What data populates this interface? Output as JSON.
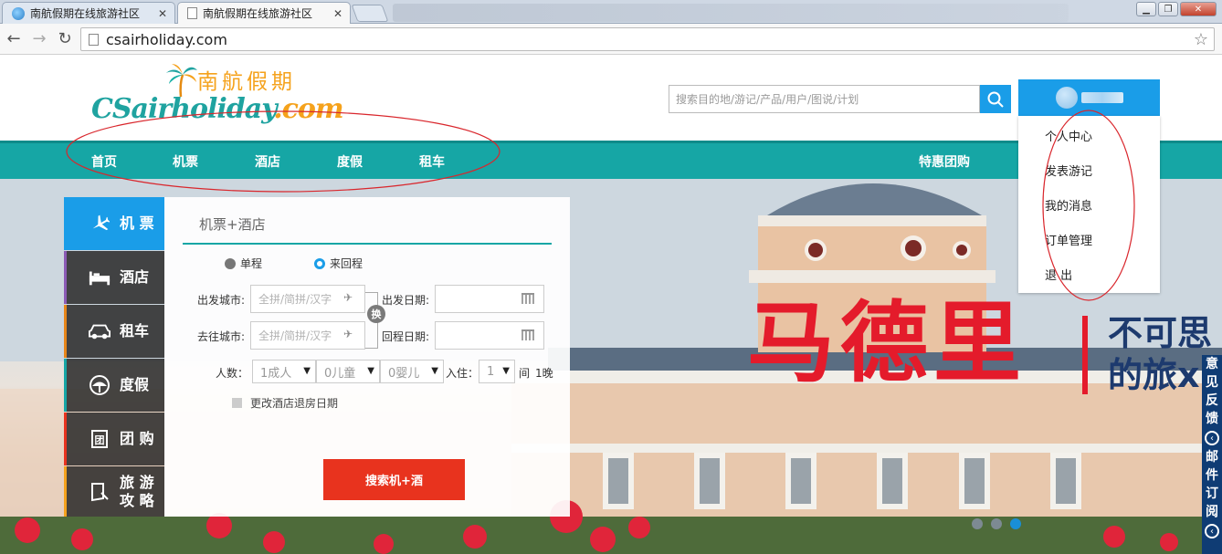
{
  "browser": {
    "tabs": [
      {
        "title": "南航假期在线旅游社区",
        "active": false
      },
      {
        "title": "南航假期在线旅游社区",
        "active": true
      }
    ],
    "url": "csairholiday.com"
  },
  "header": {
    "logo_cn": "南航假期",
    "logo_brand": "CSairholiday",
    "logo_suffix": ".com",
    "search_placeholder": "搜索目的地/游记/产品/用户/图说/计划"
  },
  "nav": {
    "items": [
      "首页",
      "机票",
      "酒店",
      "度假",
      "租车"
    ],
    "special": "特惠团购"
  },
  "user_menu": {
    "items": [
      "个人中心",
      "发表游记",
      "我的消息",
      "订单管理",
      "退 出"
    ]
  },
  "sidebar": {
    "items": [
      {
        "label": "机 票",
        "icon": "plane-icon"
      },
      {
        "label": "酒店",
        "icon": "bed-icon"
      },
      {
        "label": "租车",
        "icon": "car-icon"
      },
      {
        "label": "度假",
        "icon": "umbrella-icon"
      },
      {
        "label": "团 购",
        "icon": "group-buy-icon"
      },
      {
        "label": "旅 游\n攻 略",
        "icon": "guide-icon"
      }
    ]
  },
  "booking": {
    "tab": "机票+酒店",
    "trip_one_way": "单程",
    "trip_round": "来回程",
    "depart_city_label": "出发城市:",
    "dest_city_label": "去往城市:",
    "city_placeholder": "全拼/简拼/汉字",
    "depart_date_label": "出发日期:",
    "return_date_label": "回程日期:",
    "swap_label": "换",
    "people_label": "人数：",
    "adults": "1成人",
    "children": "0儿童",
    "infants": "0婴儿",
    "checkin_label": "入住：",
    "rooms": "1",
    "rooms_unit": "间",
    "nights": "1晚",
    "change_checkout": "更改酒店退房日期",
    "submit": "搜索机+酒"
  },
  "hero": {
    "title": "马德里",
    "sub1": "不可思",
    "sub2": "的旅x",
    "dots": [
      false,
      false,
      true
    ]
  },
  "side_tab": {
    "feedback": [
      "意",
      "见",
      "反",
      "馈"
    ],
    "subscribe": [
      "邮",
      "件",
      "订",
      "阅"
    ]
  }
}
